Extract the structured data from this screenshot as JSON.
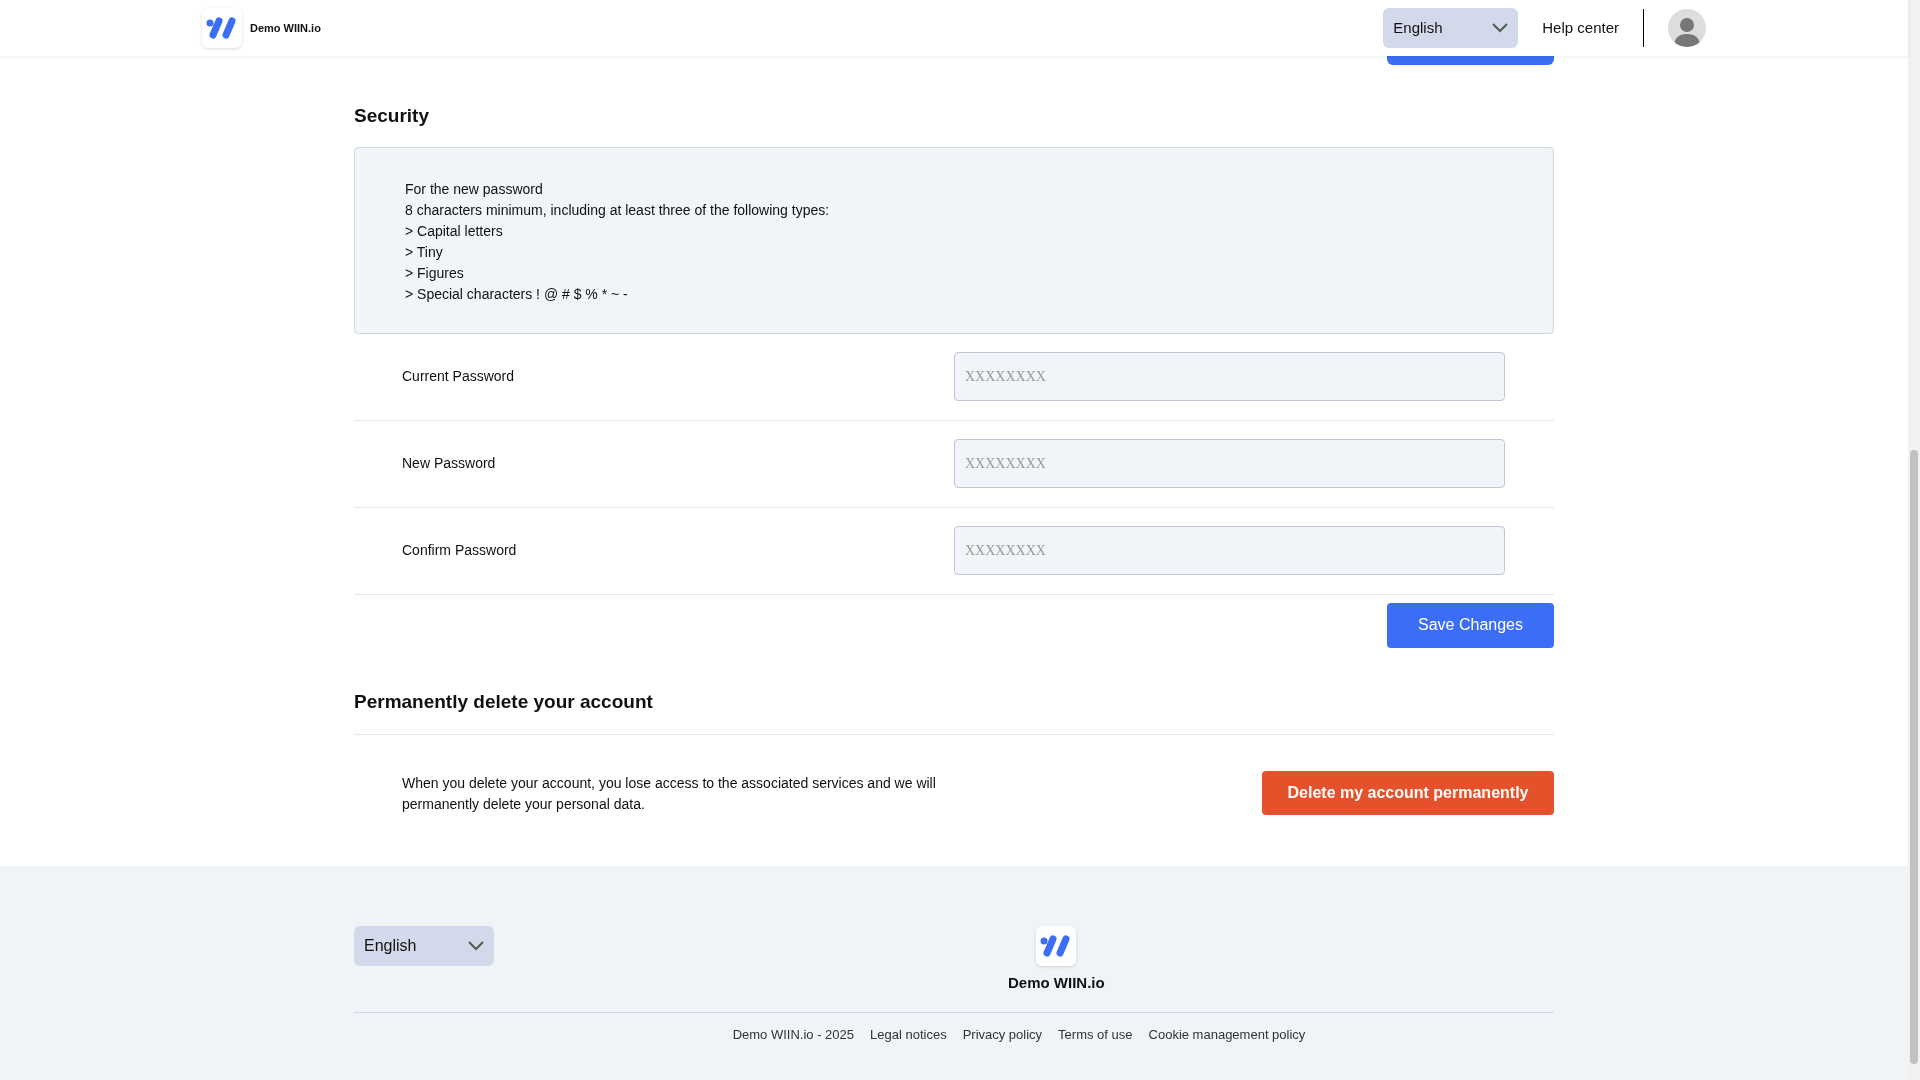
{
  "header": {
    "brand": "Demo WIIN.io",
    "language": "English",
    "help_link": "Help center"
  },
  "security": {
    "title": "Security",
    "rules": [
      "For the new password",
      "8 characters minimum, including at least three of the following types:",
      "> Capital letters",
      "> Tiny",
      "> Figures",
      "> Special characters ! @ # $ % * ~ -"
    ],
    "fields": [
      {
        "label": "Current Password",
        "placeholder": "XXXXXXXX"
      },
      {
        "label": "New Password",
        "placeholder": "XXXXXXXX"
      },
      {
        "label": "Confirm Password",
        "placeholder": "XXXXXXXX"
      }
    ],
    "save_button": "Save Changes"
  },
  "delete_account": {
    "title": "Permanently delete your account",
    "text": "When you delete your account, you lose access to the associated services and we will permanently delete your personal data.",
    "button": "Delete my account permanently"
  },
  "footer": {
    "language": "English",
    "brand": "Demo WIIN.io",
    "links": [
      "Demo WIIN.io - 2025",
      "Legal notices",
      "Privacy policy",
      "Terms of use",
      "Cookie management policy"
    ]
  }
}
